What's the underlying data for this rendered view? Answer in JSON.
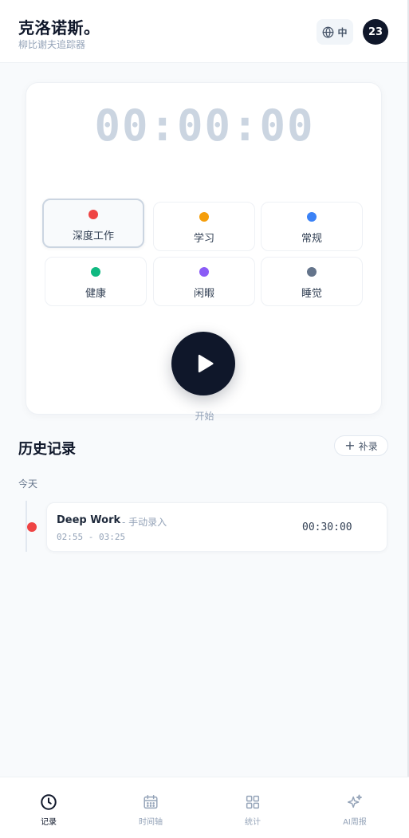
{
  "header": {
    "title": "克洛诺斯。",
    "subtitle": "柳比谢夫追踪器",
    "language_label": "中",
    "avatar_text": "23"
  },
  "timer": {
    "display": "00:00:00",
    "categories": [
      {
        "label": "深度工作",
        "color": "#ef4444",
        "selected": true
      },
      {
        "label": "学习",
        "color": "#f59e0b",
        "selected": false
      },
      {
        "label": "常规",
        "color": "#3b82f6",
        "selected": false
      },
      {
        "label": "健康",
        "color": "#10b981",
        "selected": false
      },
      {
        "label": "闲暇",
        "color": "#8b5cf6",
        "selected": false
      },
      {
        "label": "睡觉",
        "color": "#64748b",
        "selected": false
      }
    ],
    "start_label": "开始"
  },
  "history": {
    "title": "历史记录",
    "add_label": "补录",
    "day_label": "今天",
    "records": [
      {
        "name": "Deep Work",
        "tag": "- 手动录入",
        "time_range": "02:55 - 03:25",
        "duration": "00:30:00",
        "color": "#ef4444"
      }
    ]
  },
  "nav": {
    "items": [
      {
        "label": "记录",
        "icon": "clock-icon",
        "active": true
      },
      {
        "label": "时间轴",
        "icon": "calendar-icon",
        "active": false
      },
      {
        "label": "统计",
        "icon": "grid-icon",
        "active": false
      },
      {
        "label": "AI周报",
        "icon": "sparkle-icon",
        "active": false
      }
    ]
  }
}
